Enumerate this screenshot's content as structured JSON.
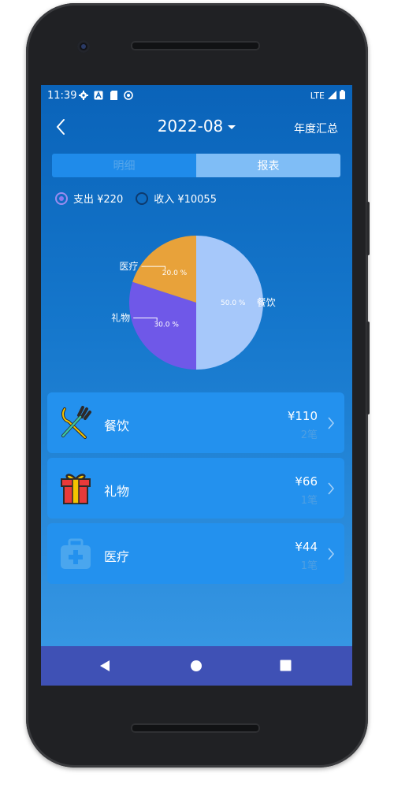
{
  "status_bar": {
    "time": "11:39",
    "network": "LTE"
  },
  "header": {
    "month": "2022-08",
    "annual_summary": "年度汇总"
  },
  "tabs": [
    {
      "label": "明细"
    },
    {
      "label": "报表"
    }
  ],
  "radios": {
    "expense": "支出 ¥220",
    "income": "收入 ¥10055"
  },
  "chart_data": {
    "type": "pie",
    "slices": [
      {
        "label": "餐饮",
        "value": 50.0,
        "percent_text": "50.0 %",
        "color": "#a6c8fa"
      },
      {
        "label": "礼物",
        "value": 30.0,
        "percent_text": "30.0 %",
        "color": "#6f58e8"
      },
      {
        "label": "医疗",
        "value": 20.0,
        "percent_text": "20.0 %",
        "color": "#e8a23a"
      }
    ]
  },
  "categories": [
    {
      "name": "餐饮",
      "amount": "¥110",
      "count": "2笔",
      "icon": "utensils-icon"
    },
    {
      "name": "礼物",
      "amount": "¥66",
      "count": "1笔",
      "icon": "gift-icon"
    },
    {
      "name": "医疗",
      "amount": "¥44",
      "count": "1笔",
      "icon": "medical-kit-icon"
    }
  ],
  "colors": {
    "appbar": "#0a63b9",
    "tab_active": "#7fbdf6",
    "item_bg": "#2391ee",
    "navbar": "#3f51b5"
  }
}
